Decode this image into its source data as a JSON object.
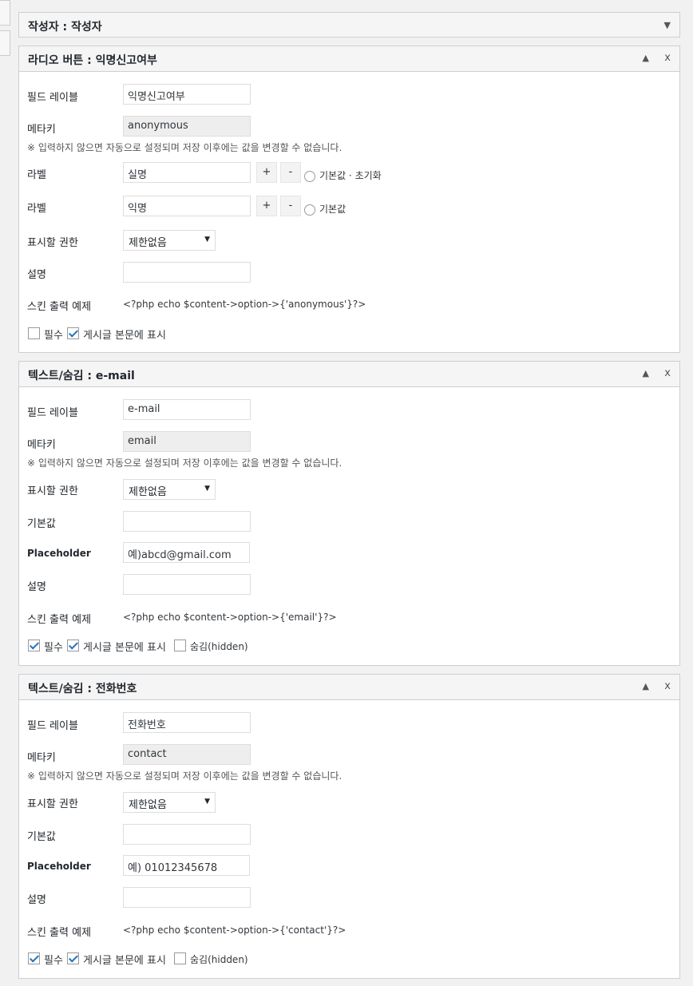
{
  "panel_author": {
    "title": "작성자 : 작성자"
  },
  "labels": {
    "field_label": "필드 레이블",
    "meta_key": "메타키",
    "meta_note": "※ 입력하지 않으면 자동으로 설정되며 저장 이후에는 값을 변경할 수 없습니다.",
    "label": "라벨",
    "permission": "표시할 권한",
    "description": "설명",
    "skin_example": "스킨 출력 예제",
    "default": "기본값",
    "placeholder": "Placeholder",
    "required": "필수",
    "show_in_post": "게시글 본문에 표시",
    "hidden": "숨김(hidden)",
    "plus": "+",
    "minus": "-",
    "default_reset": "기본값 · 초기화",
    "default_radio": "기본값",
    "up_arrow": "▲",
    "down_arrow": "▼",
    "close": "x"
  },
  "panel_radio": {
    "title": "라디오 버튼 : 익명신고여부",
    "field_label_value": "익명신고여부",
    "meta_key_value": "anonymous",
    "option1": "실명",
    "option2": "익명",
    "permission_value": "제한없음",
    "description_value": "",
    "code": "<?php echo $content->option->{'anonymous'}?>",
    "required": false,
    "show_in_post": true
  },
  "panel_email": {
    "title": "텍스트/숨김 : e-mail",
    "field_label_value": "e-mail",
    "meta_key_value": "email",
    "permission_value": "제한없음",
    "default_value": "",
    "placeholder_value": "예)abcd@gmail.com",
    "description_value": "",
    "code": "<?php echo $content->option->{'email'}?>",
    "required": true,
    "show_in_post": true,
    "hidden": false
  },
  "panel_phone": {
    "title": "텍스트/숨김 : 전화번호",
    "field_label_value": "전화번호",
    "meta_key_value": "contact",
    "permission_value": "제한없음",
    "default_value": "",
    "placeholder_value": "예) 01012345678",
    "description_value": "",
    "code": "<?php echo $content->option->{'contact'}?>",
    "required": true,
    "show_in_post": true,
    "hidden": false
  }
}
